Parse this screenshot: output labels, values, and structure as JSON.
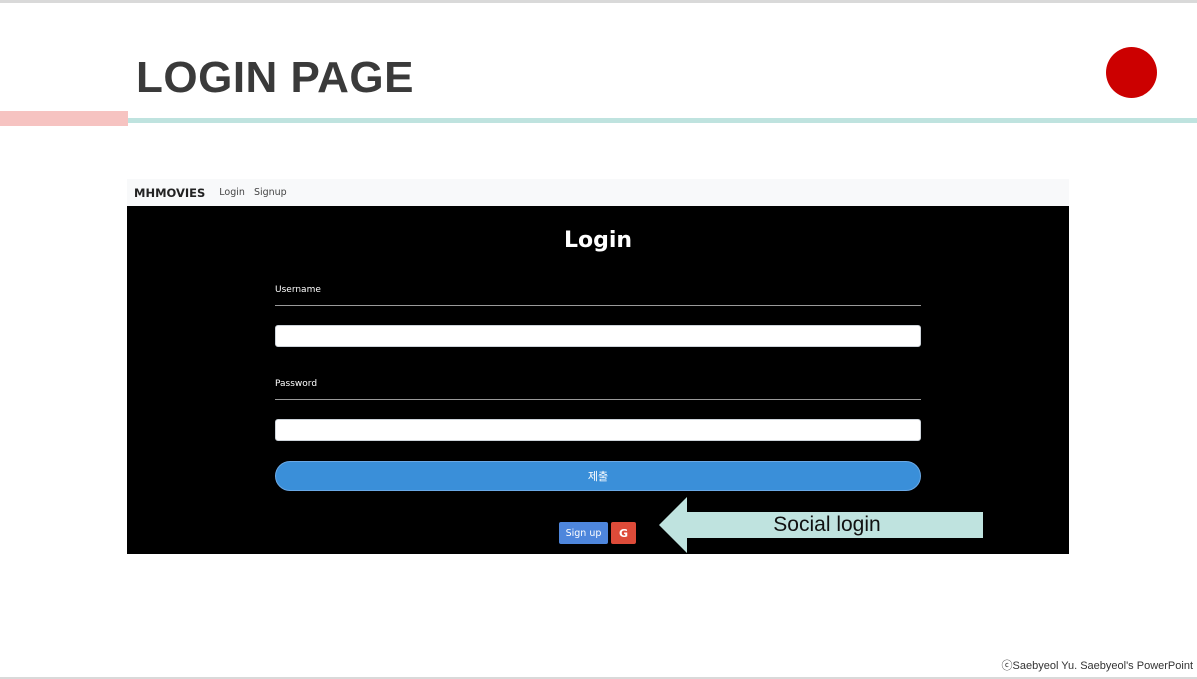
{
  "slide": {
    "title": "LOGIN PAGE",
    "copyright": "ⓒSaebyeol Yu. Saebyeol's PowerPoint",
    "colors": {
      "title": "#3a3a3a",
      "dot": "#cc0000",
      "accent_pink": "#f6c3c1",
      "accent_teal": "#bfe3df"
    }
  },
  "app": {
    "navbar": {
      "brand": "MHMOVIES",
      "links": [
        "Login",
        "Signup"
      ]
    },
    "form": {
      "heading": "Login",
      "username_label": "Username",
      "username_value": "",
      "password_label": "Password",
      "password_value": "",
      "submit_label": "제출",
      "signup_label": "Sign up",
      "google_icon": "google-icon",
      "google_glyph": "G"
    },
    "colors": {
      "background": "#000000",
      "submit": "#3a8fd9",
      "signup": "#4e86dc",
      "google": "#dd4b39"
    }
  },
  "callout": {
    "text": "Social login",
    "icon": "left-arrow-icon",
    "color": "#bfe3df"
  }
}
